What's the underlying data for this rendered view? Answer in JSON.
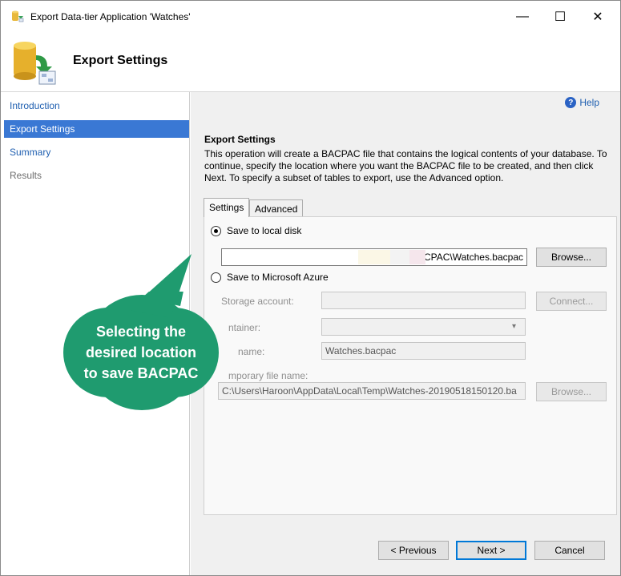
{
  "window": {
    "title": "Export Data-tier Application 'Watches'",
    "minimize_glyph": "—",
    "maximize_glyph": "☐",
    "close_glyph": "✕"
  },
  "header": {
    "title": "Export Settings",
    "icon": "database-export-icon"
  },
  "sidebar": {
    "items": [
      {
        "label": "Introduction",
        "state": "link"
      },
      {
        "label": "Export Settings",
        "state": "active"
      },
      {
        "label": "Summary",
        "state": "link"
      },
      {
        "label": "Results",
        "state": "disabled"
      }
    ]
  },
  "help": {
    "label": "Help",
    "icon": "help-icon"
  },
  "section": {
    "title": "Export Settings",
    "description": "This operation will create a BACPAC file that contains the logical contents of your database. To continue, specify the location where you want the BACPAC file to be created, and then click Next. To specify a subset of tables to export, use the Advanced option."
  },
  "tabs": [
    {
      "label": "Settings",
      "selected": true
    },
    {
      "label": "Advanced",
      "selected": false
    }
  ],
  "local": {
    "radio_label": "Save to local disk",
    "path_value": "\\BACPAC\\Watches.bacpac",
    "browse_label": "Browse..."
  },
  "azure": {
    "radio_label": "Save to Microsoft Azure",
    "storage_label": "Storage account:",
    "connect_label": "Connect...",
    "container_label": "Container:",
    "container_visible": "ntainer:",
    "filename_label": "File name:",
    "filename_visible": "name:",
    "filename_value": "Watches.bacpac",
    "temp_label": "Temporary file name:",
    "temp_visible": "mporary file name:",
    "temp_value": "C:\\Users\\Haroon\\AppData\\Local\\Temp\\Watches-20190518150120.ba",
    "browse_label": "Browse..."
  },
  "callout": {
    "line1": "Selecting the",
    "line2": "desired location",
    "line3": "to save BACPAC",
    "color": "#1f9b6f"
  },
  "footer": {
    "previous_label": "< Previous",
    "next_label": "Next >",
    "cancel_label": "Cancel"
  },
  "colors": {
    "accent": "#3a78d4",
    "link": "#1f5fb0",
    "callout": "#1f9b6f"
  }
}
